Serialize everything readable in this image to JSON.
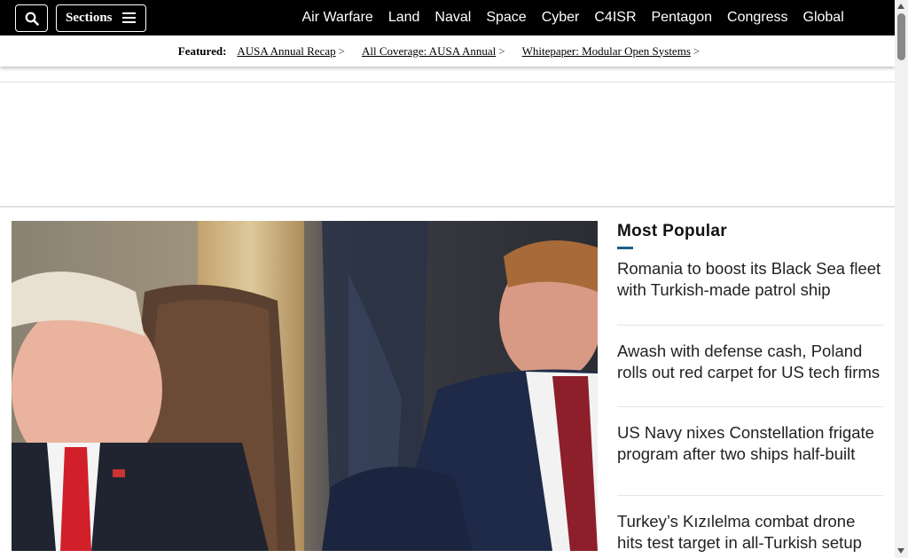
{
  "topbar": {
    "search_icon": "search-icon",
    "sections_label": "Sections",
    "sections_icon": "hamburger-icon",
    "nav": [
      "Air Warfare",
      "Land",
      "Naval",
      "Space",
      "Cyber",
      "C4ISR",
      "Pentagon",
      "Congress",
      "Global"
    ]
  },
  "featured": {
    "label": "Featured:",
    "items": [
      {
        "text": "AUSA Annual Recap",
        "chevron": ">"
      },
      {
        "text": "All Coverage: AUSA Annual",
        "chevron": ">"
      },
      {
        "text": "Whitepaper: Modular Open Systems",
        "chevron": ">"
      }
    ]
  },
  "hero": {
    "image_subject": "photo"
  },
  "most_popular": {
    "heading": "Most Popular",
    "accent_color": "#1d5f8a",
    "articles": [
      "Romania to boost its Black Sea fleet with Turkish-made patrol ship",
      "Awash with defense cash, Poland rolls out red carpet for US tech firms",
      "US Navy nixes Constellation frigate program after two ships half-built",
      "Turkey’s Kızılelma combat drone hits test target in all-Turkish setup"
    ]
  },
  "colors": {
    "topbar_bg": "#000000",
    "topbar_text": "#ffffff"
  }
}
